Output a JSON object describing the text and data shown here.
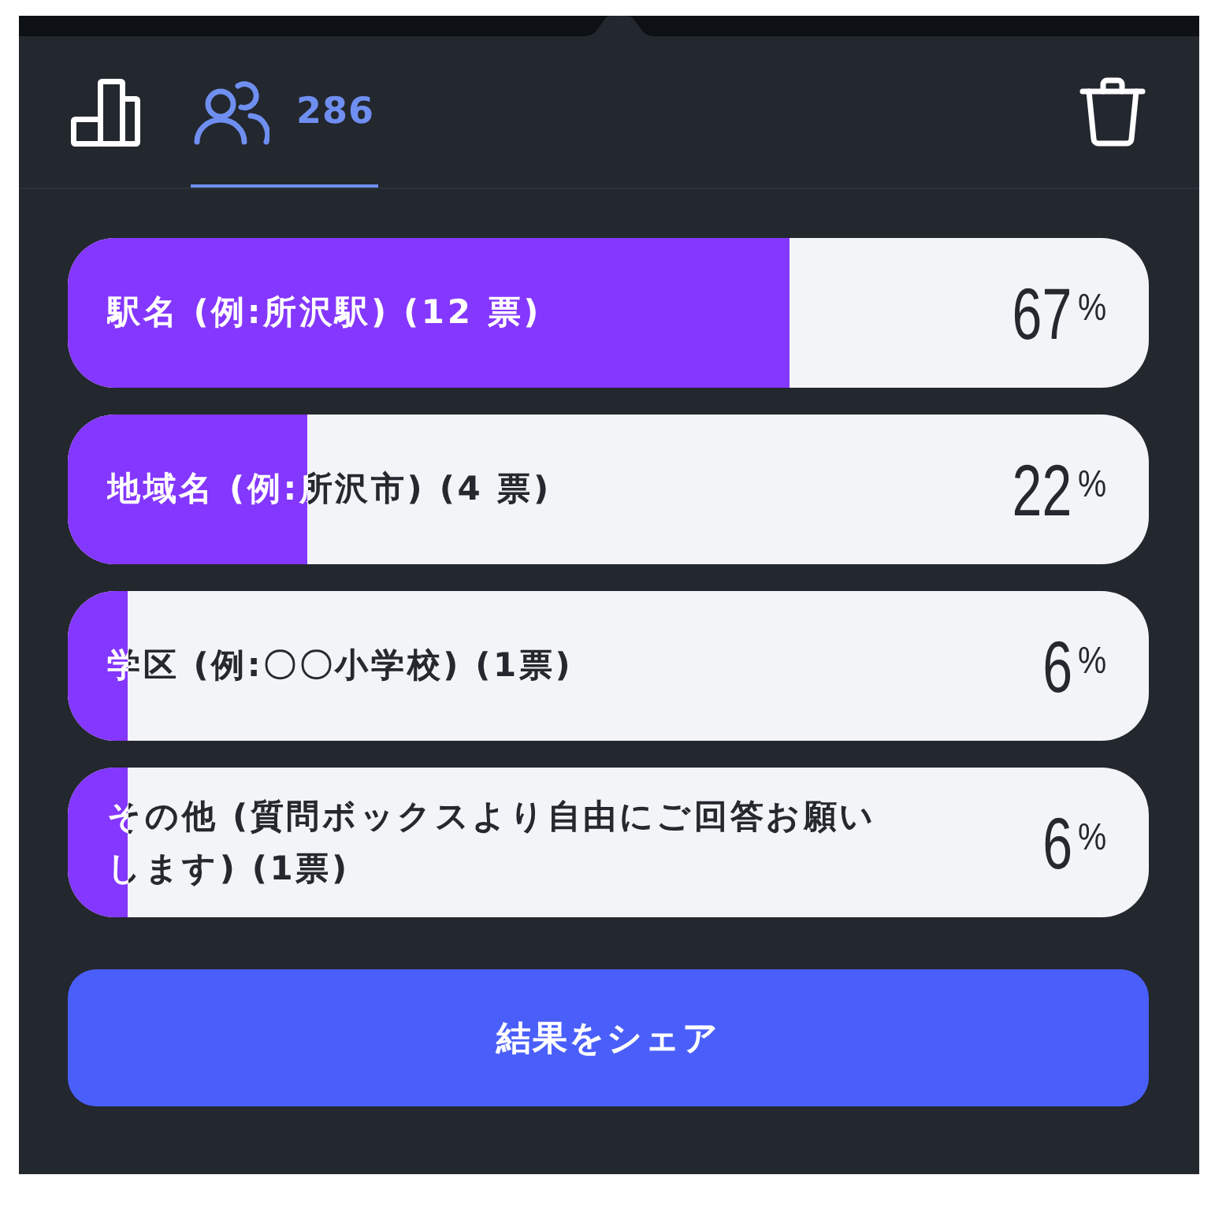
{
  "tabs": [
    {
      "kind": "chart",
      "selected": false
    },
    {
      "kind": "voters",
      "selected": true,
      "count": "286"
    }
  ],
  "options": [
    {
      "label": "駅名 (例:所沢駅) (12 票)",
      "level": 0.667,
      "percent": "67",
      "unit": "%"
    },
    {
      "label": "地域名 (例:所沢市) (4 票)",
      "level": 0.222,
      "percent": "22",
      "unit": "%"
    },
    {
      "label": "学区 (例:〇〇小学校) (1票)",
      "level": 0.056,
      "percent": "6",
      "unit": "%"
    },
    {
      "label": "その他 (質問ボックスより自由にご回答お願いします) (1票)",
      "level": 0.056,
      "percent": "6",
      "unit": "%"
    }
  ],
  "share_button": {
    "label": "結果をシェア"
  }
}
